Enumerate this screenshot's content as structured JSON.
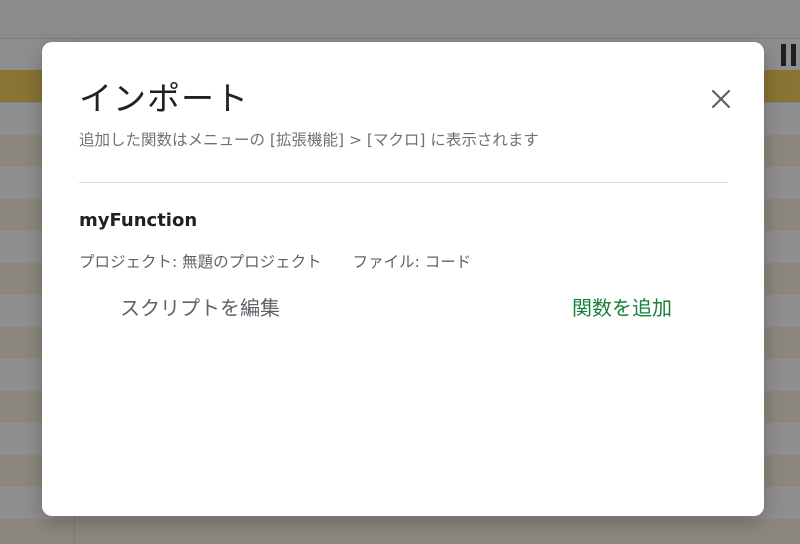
{
  "dialog": {
    "title": "インポート",
    "subtitle": "追加した関数はメニューの [拡張機能] > [マクロ] に表示されます",
    "close_icon": "close-icon"
  },
  "function_item": {
    "name": "myFunction",
    "project_label": "プロジェクト:",
    "project_value": "無題のプロジェクト",
    "file_label": "ファイル:",
    "file_value": "コード",
    "edit_script_label": "スクリプトを編集",
    "add_function_label": "関数を追加"
  },
  "colors": {
    "accent_green": "#188038",
    "overlay_gray": "#8f8f8f"
  }
}
